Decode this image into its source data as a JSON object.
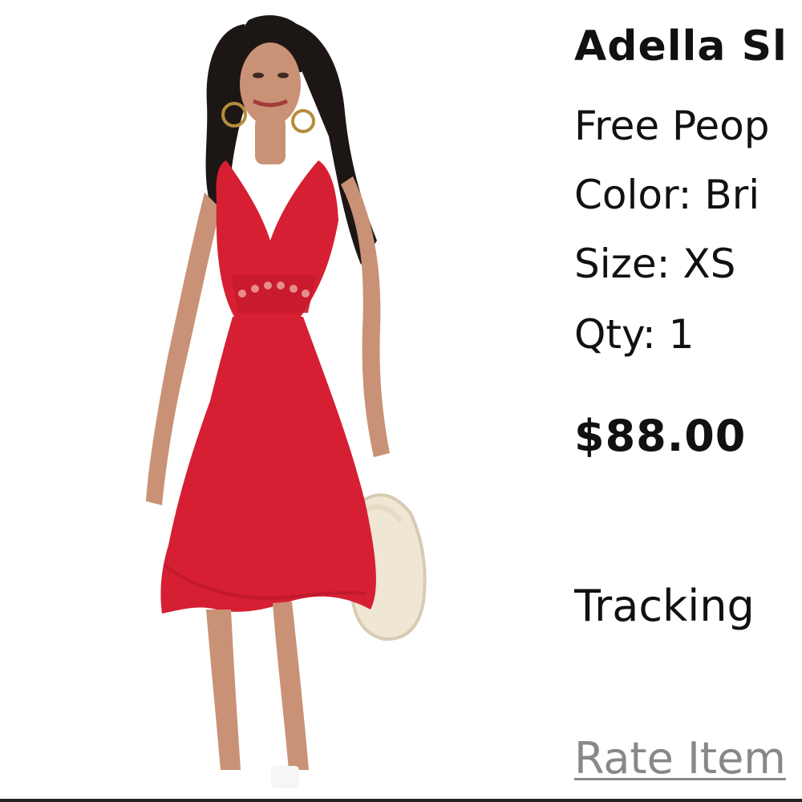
{
  "product": {
    "title": "Adella Sl",
    "brand": "Free Peop",
    "color": "Color: Bri",
    "size": "Size: XS",
    "qty": "Qty: 1",
    "price": "$88.00"
  },
  "actions": {
    "tracking_label": "Tracking",
    "rate_item_label": "Rate Item"
  },
  "image": {
    "subject": "model-in-red-lace-slip-dress",
    "dress_color": "#d61f33",
    "bag_color": "#efe6d4"
  }
}
